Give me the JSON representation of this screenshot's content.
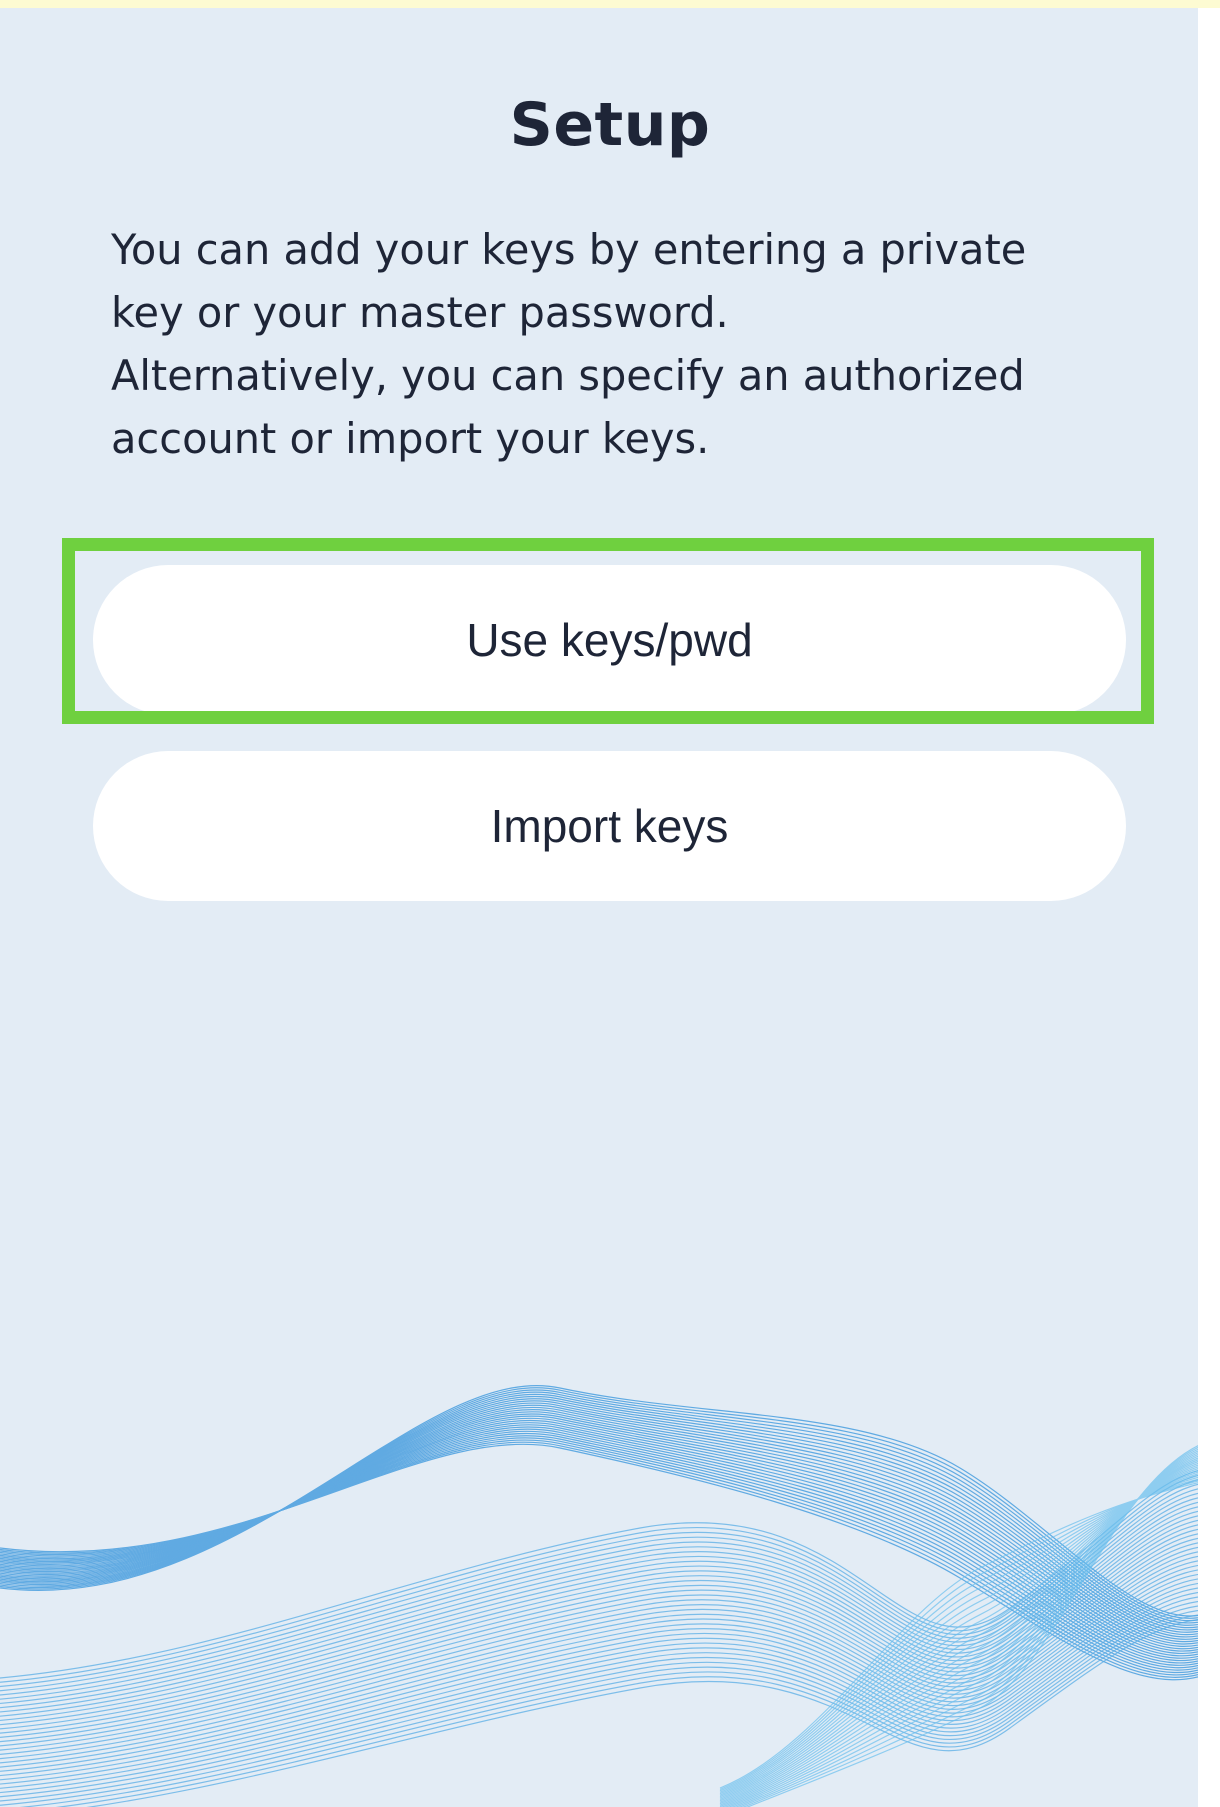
{
  "setup": {
    "title": "Setup",
    "description": "You can add your keys by entering a private\nkey or your master password.\nAlternatively, you can specify an authorized\naccount or import your keys."
  },
  "actions": {
    "use_keys_label": "Use keys/pwd",
    "import_keys_label": "Import keys"
  },
  "colors": {
    "background": "#e3ecf5",
    "top_banner": "#fdfbd2",
    "text": "#1e2537",
    "button_bg": "#ffffff",
    "highlight": "#6fd03f",
    "wave": "#4a9fdf"
  }
}
